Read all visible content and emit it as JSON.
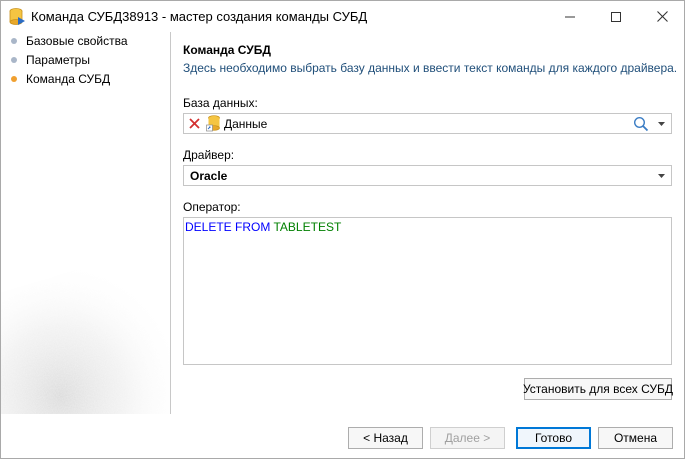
{
  "window": {
    "title": "Команда СУБД38913 - мастер создания команды СУБД"
  },
  "nav": {
    "items": [
      {
        "label": "Базовые свойства",
        "dot_color": "#a9b6c8"
      },
      {
        "label": "Параметры",
        "dot_color": "#a9b6c8"
      },
      {
        "label": "Команда СУБД",
        "dot_color": "#f0a030"
      }
    ]
  },
  "page": {
    "heading": "Команда СУБД",
    "description": "Здесь необходимо выбрать базу данных и ввести текст команды для каждого драйвера."
  },
  "database": {
    "label": "База данных:",
    "value": "Данные"
  },
  "driver": {
    "label": "Драйвер:",
    "value": "Oracle"
  },
  "operator": {
    "label": "Оператор:",
    "keyword1": "DELETE",
    "keyword2": "FROM",
    "identifier": "TABLETEST"
  },
  "buttons": {
    "apply_all": "Установить для всех СУБД",
    "back": "< Назад",
    "next": "Далее >",
    "finish": "Готово",
    "cancel": "Отмена"
  },
  "colors": {
    "accent": "#0078d7",
    "keyword": "#0000ff",
    "identifier": "#008000",
    "active_dot": "#f0a030",
    "inactive_dot": "#a9b6c8"
  }
}
